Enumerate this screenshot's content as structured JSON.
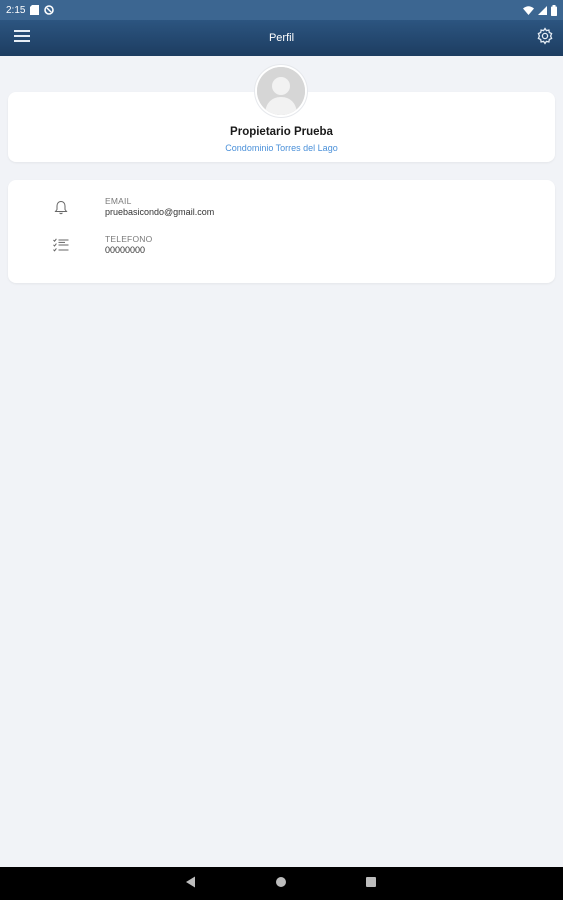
{
  "status_bar": {
    "time": "2:15",
    "icons": [
      "sd-card-icon",
      "sync-icon",
      "wifi-icon",
      "signal-icon",
      "battery-icon"
    ]
  },
  "app_bar": {
    "title": "Perfil",
    "menu_icon": "hamburger-menu-icon",
    "settings_icon": "gear-icon",
    "color": "#234a73"
  },
  "profile": {
    "name": "Propietario Prueba",
    "community": "Condominio Torres del Lago",
    "avatar_icon": "default-user-avatar",
    "accent_color": "#4a90d9"
  },
  "info": {
    "items": [
      {
        "label": "EMAIL",
        "value": "pruebasicondo@gmail.com",
        "icon": "bell-icon"
      },
      {
        "label": "TELEFONO",
        "value": "00000000",
        "icon": "checklist-icon"
      }
    ]
  },
  "nav_bar": {
    "icons": [
      "back-triangle-icon",
      "home-circle-icon",
      "recents-square-icon"
    ]
  }
}
